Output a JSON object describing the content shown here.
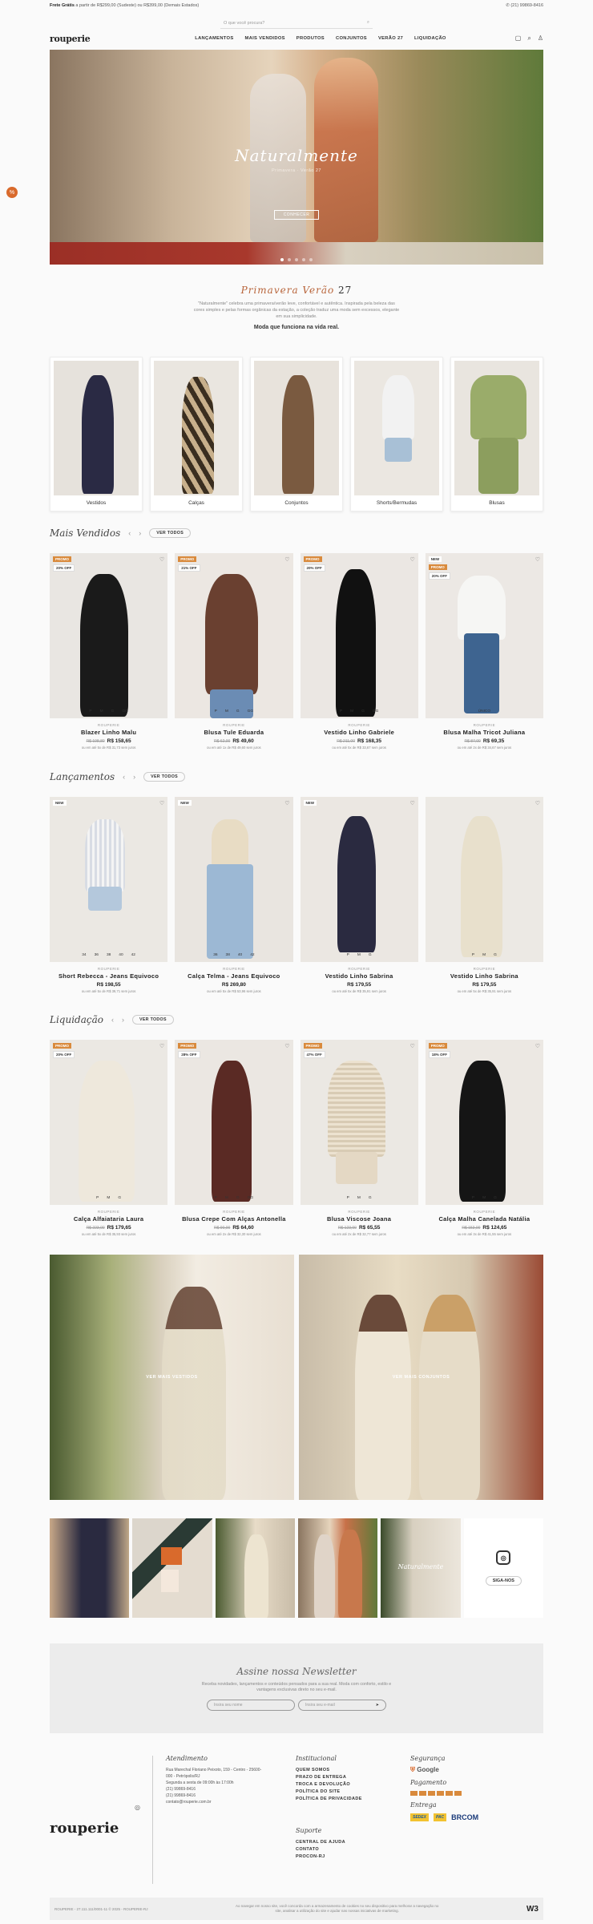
{
  "topbar": {
    "left_bold": "Frete Grátis",
    "left_text": "a partir de R$299,00 (Sudeste) ou R$399,00 (Demais Estados)",
    "right": "(21) 99869-8416"
  },
  "search": {
    "placeholder": "O que você procura?"
  },
  "brand": "rouperie",
  "menu": [
    "LANÇAMENTOS",
    "MAIS VENDIDOS",
    "PRODUTOS",
    "CONJUNTOS",
    "VERÃO 27",
    "LIQUIDAÇÃO"
  ],
  "hero": {
    "title": "Naturalmente",
    "subtitle": "Primavera · Verão 27",
    "cta": "CONHECER"
  },
  "intro": {
    "title": "Primavera Verão",
    "year": "27",
    "text": "\"Naturalmente\" celebra uma primavera/verão leve, confortável e autêntica. Inspirada pela beleza das cores simples e pelas formas orgânicas da estação, a coleção traduz uma moda sem excessos, elegante em sua simplicidade.",
    "bold": "Moda que funciona na vida real."
  },
  "categories": [
    "Vestidos",
    "Calças",
    "Conjuntos",
    "Shorts/Bermudas",
    "Blusas"
  ],
  "sections": {
    "best": {
      "title": "Mais Vendidos",
      "btn": "VER TODOS"
    },
    "new": {
      "title": "Lançamentos",
      "btn": "VER TODOS"
    },
    "sale": {
      "title": "Liquidação",
      "btn": "VER TODOS"
    }
  },
  "best": [
    {
      "badge": "PROMO",
      "off": "20% OFF",
      "brand": "ROUPERIE",
      "name": "Blazer Linho Malu",
      "old": "R$ 198,80",
      "price": "R$ 158,65",
      "inst": "ou em até 5x de R$ 31,73 sem juros",
      "sizes": [
        "P",
        "M",
        "G",
        "GG"
      ]
    },
    {
      "badge": "PROMO",
      "off": "21% OFF",
      "brand": "ROUPERIE",
      "name": "Blusa Tule Eduarda",
      "old": "R$ 62,00",
      "price": "R$ 49,60",
      "inst": "ou em até 1x de R$ 49,60 sem juros",
      "sizes": [
        "P",
        "M",
        "G",
        "GG"
      ]
    },
    {
      "badge": "PROMO",
      "off": "20% OFF",
      "brand": "ROUPERIE",
      "name": "Vestido Linho Gabriele",
      "old": "R$ 211,00",
      "price": "R$ 168,35",
      "inst": "ou em até 5x de R$ 33,67 sem juros",
      "sizes": [
        "P",
        "M",
        "G",
        "GG"
      ]
    },
    {
      "badge": "NEW",
      "off": "20% OFF",
      "brand": "ROUPERIE",
      "name": "Blusa Malha Tricot Juliana",
      "old": "R$ 87,00",
      "price": "R$ 69,35",
      "inst": "ou em até 2x de R$ 34,67 sem juros",
      "sizes": [
        "ÚNICO"
      ]
    }
  ],
  "new_items": [
    {
      "badge": "NEW",
      "brand": "ROUPERIE",
      "name": "Short Rebecca - Jeans Equivoco",
      "price": "R$ 198,55",
      "inst": "ou em até 5x de R$ 39,71 sem juros",
      "sizes": [
        "34",
        "36",
        "38",
        "40",
        "42"
      ]
    },
    {
      "badge": "NEW",
      "brand": "ROUPERIE",
      "name": "Calça Telma - Jeans Equivoco",
      "price": "R$ 269,80",
      "inst": "ou em até 5x de R$ 53,96 sem juros",
      "sizes": [
        "36",
        "38",
        "40",
        "42"
      ]
    },
    {
      "badge": "NEW",
      "brand": "ROUPERIE",
      "name": "Vestido Linho Sabrina",
      "price": "R$ 179,55",
      "inst": "ou em até 5x de R$ 35,91 sem juros",
      "sizes": [
        "P",
        "M",
        "G"
      ]
    },
    {
      "badge": "",
      "brand": "ROUPERIE",
      "name": "Vestido Linho Sabrina",
      "price": "R$ 179,55",
      "inst": "ou em até 5x de R$ 35,91 sem juros",
      "sizes": [
        "P",
        "M",
        "G"
      ]
    }
  ],
  "sale": [
    {
      "badge": "PROMO",
      "off": "20% OFF",
      "brand": "ROUPERIE",
      "name": "Calça Alfaiataria Laura",
      "old": "R$ 223,00",
      "price": "R$ 179,65",
      "inst": "ou em até 5x de R$ 35,93 sem juros",
      "sizes": [
        "P",
        "M",
        "G"
      ]
    },
    {
      "badge": "PROMO",
      "off": "28% OFF",
      "brand": "ROUPERIE",
      "name": "Blusa Crepe Com Alças Antonella",
      "old": "R$ 90,00",
      "price": "R$ 64,60",
      "inst": "ou em até 2x de R$ 32,30 sem juros",
      "sizes": [
        "P",
        "M",
        "G",
        "GG"
      ]
    },
    {
      "badge": "PROMO",
      "off": "47% OFF",
      "brand": "ROUPERIE",
      "name": "Blusa Viscose Joana",
      "old": "R$ 123,00",
      "price": "R$ 65,55",
      "inst": "ou em até 2x de R$ 32,77 sem juros",
      "sizes": [
        "P",
        "M",
        "G"
      ]
    },
    {
      "badge": "PROMO",
      "off": "18% OFF",
      "brand": "ROUPERIE",
      "name": "Calça Malha Canelada Natália",
      "old": "R$ 153,00",
      "price": "R$ 124,65",
      "inst": "ou em até 3x de R$ 41,55 sem juros",
      "sizes": [
        "P",
        "M",
        "G"
      ]
    }
  ],
  "banners": [
    "VER MAIS VESTIDOS",
    "VER MAIS CONJUNTOS"
  ],
  "instagram": {
    "caption": "Naturalmente",
    "follow": "SIGA-NOS"
  },
  "newsletter": {
    "title": "Assine nossa Newsletter",
    "text": "Receba novidades, lançamentos e conteúdos pensados para a sua real. Moda com conforto, estilo e vantagens exclusivas direto no seu e-mail.",
    "name_ph": "Insira seu nome",
    "email_ph": "Insira seu e-mail"
  },
  "footer": {
    "atend_title": "Atendimento",
    "atend": [
      "Rua Marechal Floriano Peixoto, 159 - Centro - 25600-000 - Petrópolis/RJ",
      "Segunda a sexta de 09:00h às 17:00h",
      "(21) 99869-8416",
      "(21) 99869-8416",
      "contato@rouperie.com.br"
    ],
    "inst_title": "Institucional",
    "inst": [
      "QUEM SOMOS",
      "PRAZO DE ENTREGA",
      "TROCA E DEVOLUÇÃO",
      "POLÍTICA DO SITE",
      "POLÍTICA DE PRIVACIDADE"
    ],
    "sup_title": "Suporte",
    "sup": [
      "CENTRAL DE AJUDA",
      "CONTATO",
      "PROCON-RJ"
    ],
    "seg_title": "Segurança",
    "seg": "Google",
    "pag_title": "Pagamento",
    "ent_title": "Entrega",
    "ent": [
      "SEDEX",
      "PAC",
      "BRCOM"
    ]
  },
  "bottom": {
    "left": "ROUPERIE - 27.111.111/0001-11 © 2025 - ROUPERIE-RJ",
    "center": "Ao navegar em nosso site, você concorda com a armazenamento de cookies no seu dispositivo para melhorar a navegação no site, analisar a utilização do site e ajudar nas nossas iniciativas de marketing.",
    "right": "W3"
  },
  "colors": {
    "accent": "#d98a3c",
    "brand": "#b8643a"
  }
}
